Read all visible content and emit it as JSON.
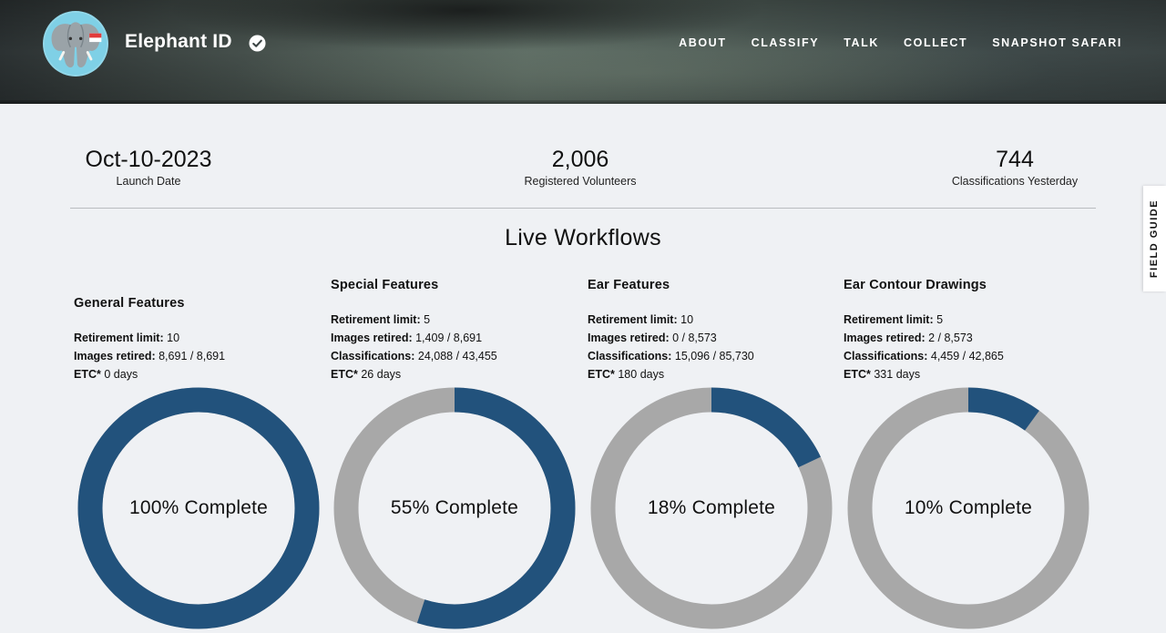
{
  "header": {
    "project_title": "Elephant ID",
    "nav": [
      "ABOUT",
      "CLASSIFY",
      "TALK",
      "COLLECT",
      "SNAPSHOT SAFARI"
    ]
  },
  "stats": [
    {
      "value": "Oct-10-2023",
      "label": "Launch Date"
    },
    {
      "value": "2,006",
      "label": "Registered Volunteers"
    },
    {
      "value": "744",
      "label": "Classifications Yesterday"
    }
  ],
  "section_title": "Live Workflows",
  "labels": {
    "retirement_limit": "Retirement limit:",
    "images_retired": "Images retired:",
    "classifications": "Classifications:",
    "etc": "ETC*"
  },
  "workflows": [
    {
      "title": "General Features",
      "retirement_limit": "10",
      "images_retired": "8,691 / 8,691",
      "classifications": null,
      "etc": "0 days",
      "complete_label": "100% Complete"
    },
    {
      "title": "Special Features",
      "retirement_limit": "5",
      "images_retired": "1,409 / 8,691",
      "classifications": "24,088 / 43,455",
      "etc": "26 days",
      "complete_label": "55% Complete"
    },
    {
      "title": "Ear Features",
      "retirement_limit": "10",
      "images_retired": "0 / 8,573",
      "classifications": "15,096 / 85,730",
      "etc": "180 days",
      "complete_label": "18% Complete"
    },
    {
      "title": "Ear Contour Drawings",
      "retirement_limit": "5",
      "images_retired": "2 / 8,573",
      "classifications": "4,459 / 42,865",
      "etc": "331 days",
      "complete_label": "10% Complete"
    }
  ],
  "chart_data": [
    {
      "type": "pie",
      "categories": [
        "Complete",
        "Remaining"
      ],
      "values": [
        100,
        0
      ]
    },
    {
      "type": "pie",
      "categories": [
        "Complete",
        "Remaining"
      ],
      "values": [
        55,
        45
      ]
    },
    {
      "type": "pie",
      "categories": [
        "Complete",
        "Remaining"
      ],
      "values": [
        18,
        82
      ]
    },
    {
      "type": "pie",
      "categories": [
        "Complete",
        "Remaining"
      ],
      "values": [
        10,
        90
      ]
    }
  ],
  "colors": {
    "complete": "#22527c",
    "remaining": "#a8a8a8",
    "background": "#eff1f4"
  },
  "field_guide_label": "FIELD GUIDE"
}
